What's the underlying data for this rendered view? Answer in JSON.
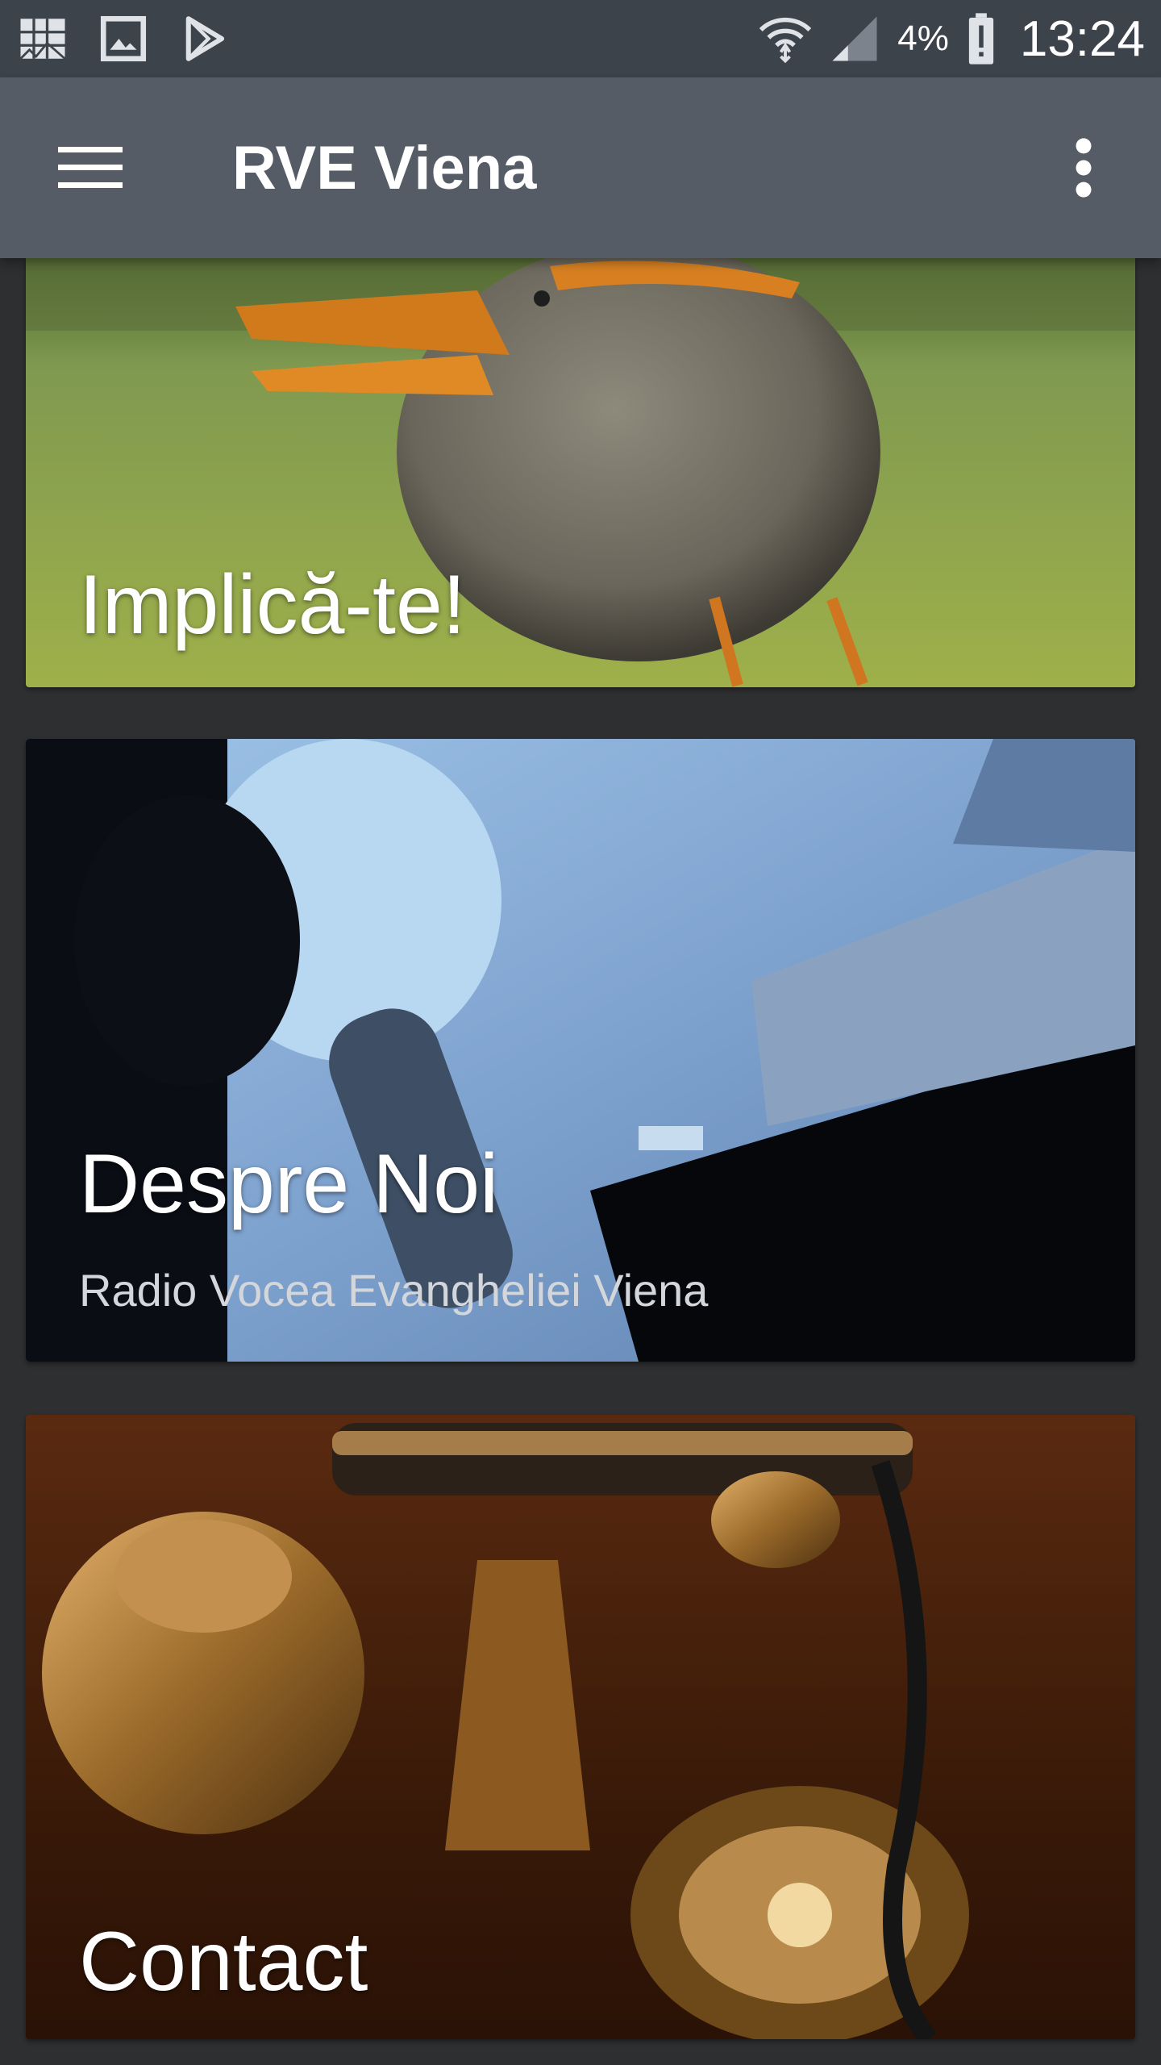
{
  "status_bar": {
    "left_icons": [
      "gallery-mosaic-icon",
      "image-icon",
      "play-store-icon"
    ],
    "right_icons": [
      "wifi-icon",
      "signal-icon",
      "battery-alert-icon"
    ],
    "battery": "4%",
    "time": "13:24"
  },
  "app_bar": {
    "title": "RVE Viena",
    "menu_icon": "hamburger-icon",
    "more_icon": "more-vert-icon"
  },
  "cards": [
    {
      "title": "Implică-te!",
      "subtitle": "",
      "image": "metal-bird-photo"
    },
    {
      "title": "Despre Noi",
      "subtitle": "Radio Vocea Evangheliei Viena",
      "image": "radio-host-microphone-photo"
    },
    {
      "title": "Contact",
      "subtitle": "",
      "image": "vintage-telephone-photo"
    }
  ],
  "colors": {
    "status_bar_bg": "#3d434b",
    "app_bar_bg": "#555c66",
    "page_bg": "#2e2f31",
    "text_primary": "#ffffff",
    "text_secondary": "#d3d6db"
  }
}
